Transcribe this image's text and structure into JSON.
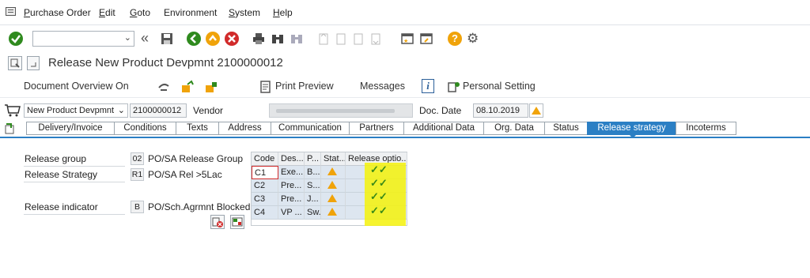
{
  "menu": {
    "items": [
      {
        "first": "P",
        "rest": "urchase Order"
      },
      {
        "first": "E",
        "rest": "dit"
      },
      {
        "first": "G",
        "rest": "oto"
      },
      {
        "first": "",
        "rest": "Environment"
      },
      {
        "first": "S",
        "rest": "ystem"
      },
      {
        "first": "H",
        "rest": "elp"
      }
    ]
  },
  "toolbar": {
    "command_value": ""
  },
  "title": "Release New Product Devpmnt 2100000012",
  "app_toolbar": {
    "document_overview": "Document Overview On",
    "print_preview": "Print Preview",
    "messages": "Messages",
    "personal_setting": "Personal Setting"
  },
  "header": {
    "doc_type": "New Product Devpmnt",
    "po_number": "2100000012",
    "vendor_label": "Vendor",
    "doc_date_label": "Doc. Date",
    "doc_date": "08.10.2019"
  },
  "tabs": [
    "Delivery/Invoice",
    "Conditions",
    "Texts",
    "Address",
    "Communication",
    "Partners",
    "Additional Data",
    "Org. Data",
    "Status",
    "Release strategy",
    "Incoterms"
  ],
  "active_tab": "Release strategy",
  "release": {
    "group_label": "Release group",
    "group_code": "02",
    "group_desc": "PO/SA Release Group",
    "strategy_label": "Release Strategy",
    "strategy_code": "R1",
    "strategy_desc": "PO/SA Rel >5Lac",
    "indicator_label": "Release indicator",
    "indicator_code": "B",
    "indicator_desc": "PO/Sch.Agrmnt Blocked"
  },
  "release_table": {
    "headers": [
      "Code",
      "Des...",
      "P...",
      "Stat...",
      "Release optio..."
    ],
    "rows": [
      {
        "code": "C1",
        "desc": "Exe...",
        "p": "B..."
      },
      {
        "code": "C2",
        "desc": "Pre...",
        "p": "S..."
      },
      {
        "code": "C3",
        "desc": "Pre...",
        "p": "J..."
      },
      {
        "code": "C4",
        "desc": "VP ...",
        "p": "Sw..."
      }
    ]
  },
  "colors": {
    "accent": "#2b7fc4",
    "highlight": "#f4f20a",
    "status_yellow": "#f0a30a",
    "check_green": "#3a8a18"
  },
  "icons": [
    "checkmark-icon",
    "back-icon",
    "save-icon",
    "exit-icon",
    "cancel-icon",
    "print-icon",
    "find-icon",
    "help-icon",
    "gear-icon"
  ]
}
